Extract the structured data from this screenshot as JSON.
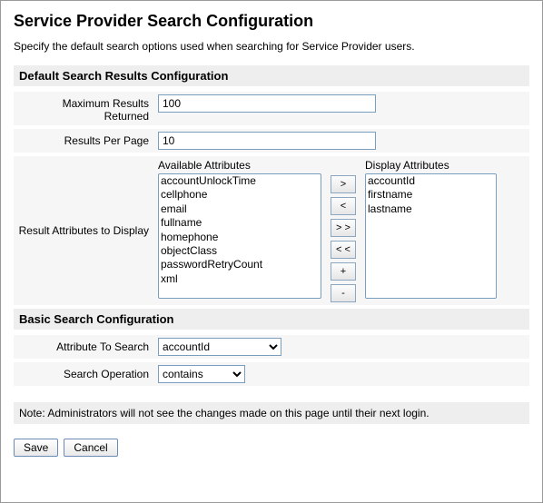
{
  "page": {
    "title": "Service Provider Search Configuration",
    "intro": "Specify the default search options used when searching for Service Provider users."
  },
  "default_results": {
    "header": "Default Search Results Configuration",
    "max_results": {
      "label": "Maximum Results Returned",
      "value": "100"
    },
    "per_page": {
      "label": "Results Per Page",
      "value": "10"
    },
    "attributes": {
      "label": "Result Attributes to Display",
      "available_header": "Available Attributes",
      "display_header": "Display Attributes",
      "available": [
        "accountUnlockTime",
        "cellphone",
        "email",
        "fullname",
        "homephone",
        "objectClass",
        "passwordRetryCount",
        "xml"
      ],
      "display": [
        "accountId",
        "firstname",
        "lastname"
      ],
      "buttons": {
        "add": ">",
        "remove": "<",
        "add_all": "> >",
        "remove_all": "< <",
        "move_up": "+",
        "move_down": "-"
      }
    }
  },
  "basic_search": {
    "header": "Basic Search Configuration",
    "attribute": {
      "label": "Attribute To Search",
      "selected": "accountId"
    },
    "operation": {
      "label": "Search Operation",
      "selected": "contains"
    }
  },
  "note": "Note: Administrators will not see the changes made on this page until their next login.",
  "buttons": {
    "save": "Save",
    "cancel": "Cancel"
  }
}
